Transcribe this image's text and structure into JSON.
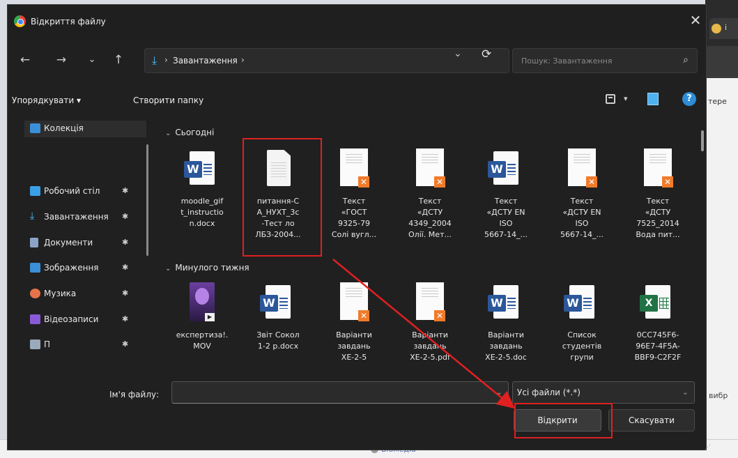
{
  "dialog": {
    "title": "Відкриття файлу",
    "close_label": "✕"
  },
  "nav": {
    "back": "←",
    "forward": "→",
    "recent": "⌄",
    "up": "↑",
    "address_sep": "›",
    "address": "Завантаження",
    "address_trail": "›",
    "refresh": "⟳",
    "search_placeholder": "Пошук: Завантаження"
  },
  "toolbar": {
    "organize": "Упорядкувати ▾",
    "new_folder": "Створити папку"
  },
  "sidebar": {
    "collection": "Колекція",
    "items": [
      {
        "label": "Робочий стіл",
        "color": "#3aa0e6"
      },
      {
        "label": "Завантаження",
        "color": "#4cc2ff"
      },
      {
        "label": "Документи",
        "color": "#8aa4c8"
      },
      {
        "label": "Зображення",
        "color": "#3a8fd6"
      },
      {
        "label": "Музика",
        "color": "#e8734a"
      },
      {
        "label": "Відеозаписи",
        "color": "#8a5ad6"
      },
      {
        "label": "П",
        "color": "#9ab"
      }
    ]
  },
  "groups": {
    "today": "Сьогодні",
    "last_week": "Минулого тижня"
  },
  "files_today": [
    {
      "name": "moodle_gif\nt_instructio\nn.docx",
      "type": "word"
    },
    {
      "name": "питання-С\nА_НУХТ_3с\n-Тест ло\nЛБЗ-2004...",
      "type": "blank"
    },
    {
      "name": "Текст\n«ГОСТ\n9325-79\nСолі вугл...",
      "type": "pdf"
    },
    {
      "name": "Текст\n«ДСТУ\n4349_2004\nОлії. Мет...",
      "type": "pdf"
    },
    {
      "name": "Текст\n«ДСТУ EN\nISO\n5667-14_...",
      "type": "word"
    },
    {
      "name": "Текст\n«ДСТУ EN\nISO\n5667-14_...",
      "type": "pdf"
    },
    {
      "name": "Текст\n«ДСТУ\n7525_2014\nВода пит...",
      "type": "pdf"
    }
  ],
  "files_week": [
    {
      "name": "експертиза!.\nMOV",
      "type": "mov"
    },
    {
      "name": "Звіт Сокол\n1-2 р.docx",
      "type": "word"
    },
    {
      "name": "Варіанти\nзавдань\nХЕ-2-5",
      "type": "pdf"
    },
    {
      "name": "Варіанти\nзавдань\nХЕ-2-5.pdf",
      "type": "pdf"
    },
    {
      "name": "Варіанти\nзавдань\nХЕ-2-5.doc",
      "type": "word"
    },
    {
      "name": "Список\nстудентів\nгрупи",
      "type": "word"
    },
    {
      "name": "0CC745F6-\n96E7-4F5A-\nBBF9-C2F2F",
      "type": "excel"
    }
  ],
  "bottom": {
    "filename_label": "Ім'я файлу:",
    "filename_value": "",
    "filter": "Усі файли (*.*)",
    "open": "Відкрити",
    "cancel": "Скасувати"
  },
  "background": {
    "tab_text": "і",
    "right_text": "тере",
    "vybr_text": "вибр",
    "bottom_link": "Біомедіа"
  },
  "colors": {
    "highlight": "#e02020",
    "dialog_bg": "#202020",
    "accent": "#4cc2ff"
  }
}
